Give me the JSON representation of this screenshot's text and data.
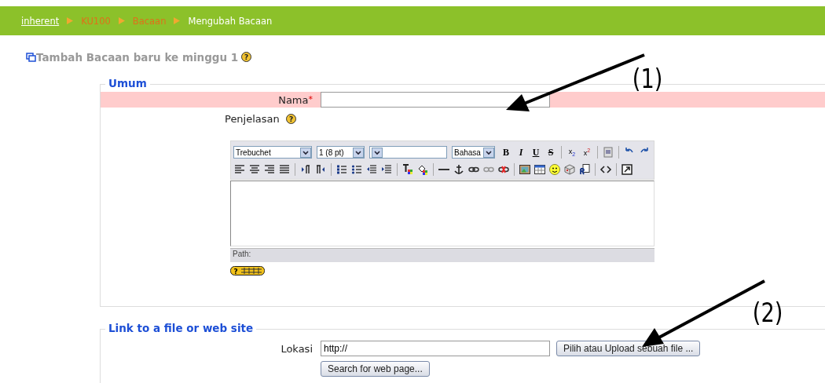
{
  "breadcrumb": [
    {
      "label": "inherent",
      "kind": "home"
    },
    {
      "label": "KU100",
      "kind": "link"
    },
    {
      "label": "Bacaan",
      "kind": "link"
    },
    {
      "label": "Mengubah Bacaan",
      "kind": "current"
    }
  ],
  "heading": "Tambah Bacaan baru ke minggu 1",
  "heading_help": "?",
  "sections": [
    {
      "legend": "Umum",
      "name_field": {
        "label": "Nama",
        "required_mark": "*",
        "required": true
      },
      "description": {
        "label": "Penjelasan",
        "help": "?",
        "editor": {
          "font": "Trebuchet",
          "size": "1 (8 pt)",
          "language": "Bahasa",
          "keyboard_help": "?",
          "format_buttons": [
            "B",
            "I",
            "U",
            "S"
          ],
          "script_buttons": [
            {
              "base": "x",
              "mark": "2",
              "kind": "sub"
            },
            {
              "base": "x",
              "mark": "2",
              "kind": "sup"
            }
          ],
          "path_label": "Path:"
        }
      }
    },
    {
      "legend": "Link to a file or web site",
      "location": {
        "label": "Lokasi",
        "value": "http://"
      },
      "buttons": [
        "Pilih atau Upload sebuah file ...",
        "Search for web page..."
      ]
    }
  ],
  "annotations": [
    {
      "label": "(1)"
    },
    {
      "label": "(2)"
    }
  ]
}
